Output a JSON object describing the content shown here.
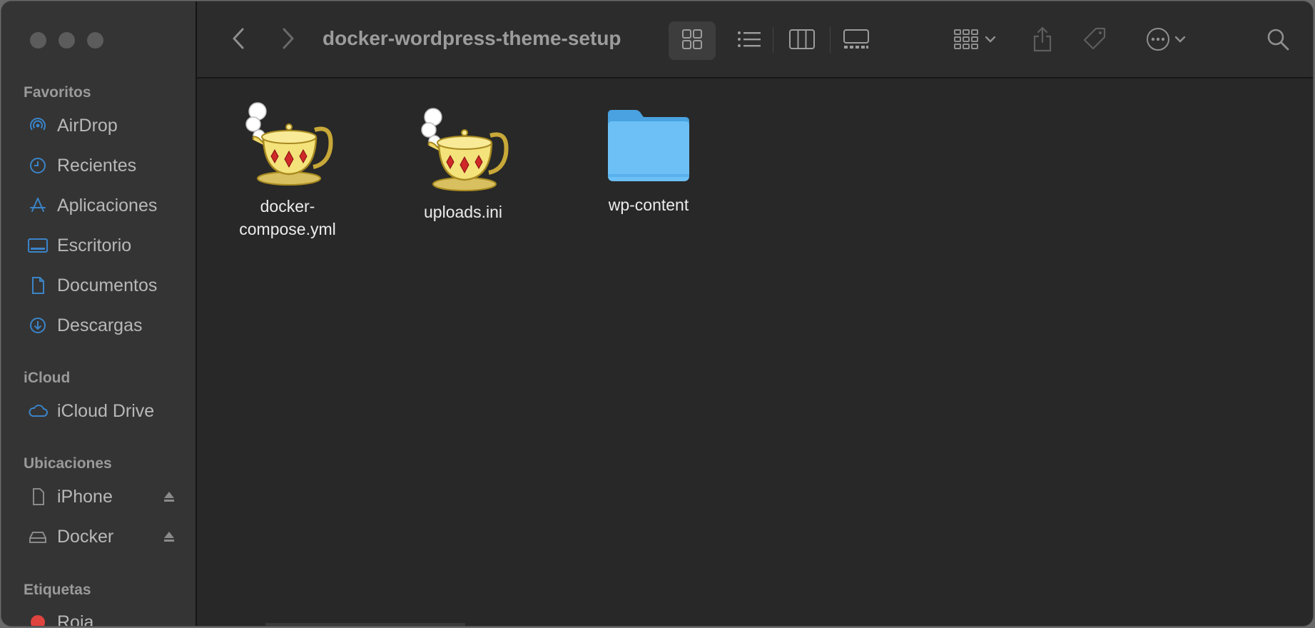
{
  "window": {
    "title": "docker-wordpress-theme-setup"
  },
  "sidebar": {
    "sections": {
      "favorites": "Favoritos",
      "icloud": "iCloud",
      "locations": "Ubicaciones",
      "tags": "Etiquetas"
    },
    "favorites": [
      {
        "label": "AirDrop",
        "icon": "airdrop-icon"
      },
      {
        "label": "Recientes",
        "icon": "clock-icon"
      },
      {
        "label": "Aplicaciones",
        "icon": "applications-icon"
      },
      {
        "label": "Escritorio",
        "icon": "desktop-icon"
      },
      {
        "label": "Documentos",
        "icon": "document-icon"
      },
      {
        "label": "Descargas",
        "icon": "download-icon"
      }
    ],
    "icloud": [
      {
        "label": "iCloud Drive",
        "icon": "cloud-icon"
      }
    ],
    "locations": [
      {
        "label": "iPhone",
        "icon": "phone-icon"
      },
      {
        "label": "Docker",
        "icon": "drive-icon"
      }
    ],
    "tags": [
      {
        "label": "Roja",
        "color": "#e0443e"
      }
    ]
  },
  "files": [
    {
      "name_line1": "docker-",
      "name_line2": "compose.yml",
      "icon": "teapot-file-icon"
    },
    {
      "name_line1": "uploads.ini",
      "name_line2": "",
      "icon": "teapot-file-icon"
    },
    {
      "name_line1": "wp-content",
      "name_line2": "",
      "icon": "folder-icon"
    }
  ],
  "colors": {
    "accent": "#3b84c8",
    "folder": "#5ab4f0",
    "background": "#282828",
    "sidebar": "#343434"
  }
}
